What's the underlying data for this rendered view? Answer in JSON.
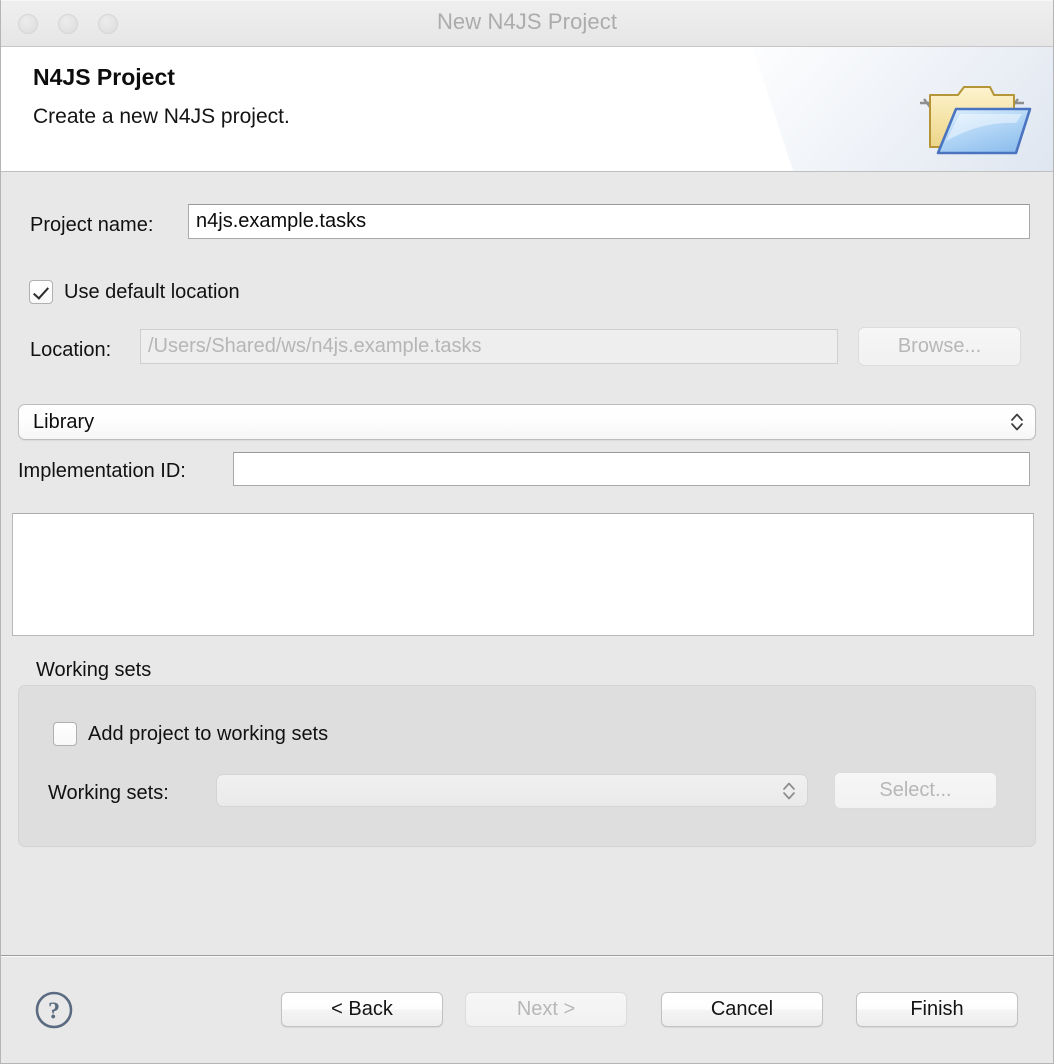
{
  "window": {
    "title": "New N4JS Project",
    "traffic_lights": [
      "close",
      "minimize",
      "maximize"
    ]
  },
  "header": {
    "title": "N4JS Project",
    "subtitle": "Create a new N4JS project.",
    "icon": "open-folder-icon"
  },
  "form": {
    "project_name_label": "Project name:",
    "project_name_value": "n4js.example.tasks",
    "use_default_location_label": "Use default location",
    "use_default_location_checked": true,
    "location_label": "Location:",
    "location_placeholder": "/Users/Shared/ws/n4js.example.tasks",
    "location_value": "",
    "location_disabled": true,
    "browse_label": "Browse...",
    "browse_disabled": true,
    "project_type_value": "Library",
    "project_type_options": [
      "Library"
    ],
    "implementation_id_label": "Implementation ID:",
    "implementation_id_value": "",
    "list_items": []
  },
  "working_sets": {
    "group_label": "Working sets",
    "add_checkbox_label": "Add project to working sets",
    "add_checkbox_checked": false,
    "working_sets_label": "Working sets:",
    "working_sets_value": "",
    "working_sets_disabled": true,
    "select_label": "Select...",
    "select_disabled": true
  },
  "footer": {
    "help_icon": "help-question-icon",
    "back_label": "< Back",
    "back_disabled": false,
    "next_label": "Next >",
    "next_disabled": true,
    "cancel_label": "Cancel",
    "cancel_disabled": false,
    "finish_label": "Finish",
    "finish_disabled": false
  },
  "colors": {
    "window_bg": "#e8e8e8",
    "header_bg": "#ffffff",
    "titlebar_text": "#acacac",
    "text": "#111111",
    "disabled_text": "#b5b5b5",
    "field_border": "#a9a9a9",
    "help_icon": "#5a6a80",
    "folder_yellow": "#f2dc9b",
    "folder_blue": "#b8d8f5"
  }
}
